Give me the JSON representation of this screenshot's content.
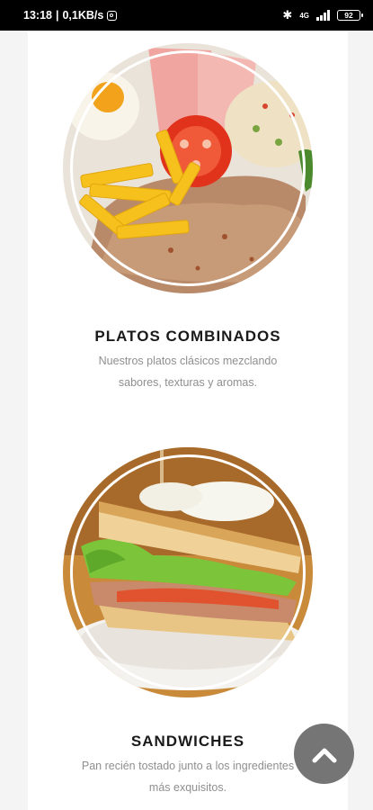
{
  "status_bar": {
    "time": "13:18",
    "network_speed": "0,1KB/s",
    "signal_label": "4G",
    "battery": "92",
    "notification_icon": "instagram-icon",
    "bluetooth_icon": "bluetooth-icon"
  },
  "sections": [
    {
      "title": "PLATOS COMBINADOS",
      "description_line1": "Nuestros platos clásicos mezclando",
      "description_line2": "sabores, texturas y aromas.",
      "image": "combined-plate-photo"
    },
    {
      "title": "SANDWICHES",
      "description_line1": "Pan recién tostado junto a los ingredientes",
      "description_line2": "más exquisitos.",
      "image": "sandwich-photo"
    }
  ],
  "scroll_top_button": {
    "icon": "chevron-up-icon"
  },
  "colors": {
    "background": "#f4f4f4",
    "card": "#ffffff",
    "title": "#1a1a1a",
    "description": "#8f8f8f",
    "button": "#6e6e6e"
  }
}
